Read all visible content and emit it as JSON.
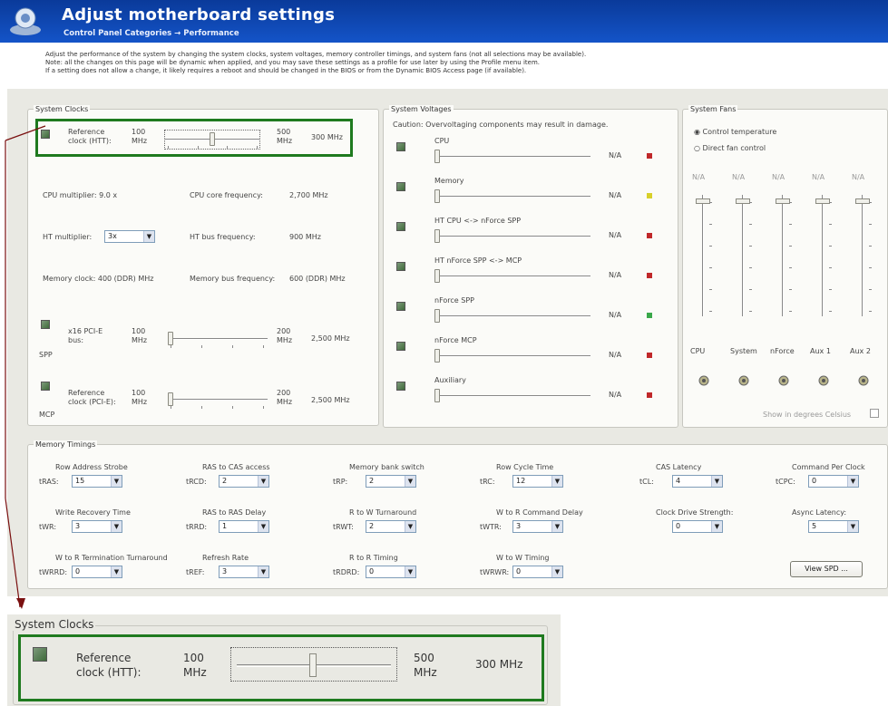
{
  "header": {
    "title": "Adjust motherboard settings",
    "subtitle": "Control Panel Categories  →  Performance"
  },
  "intro": [
    "Adjust the performance of the system by changing the system clocks, system voltages, memory controller timings, and system fans (not all selections may be available).",
    "Note: all the changes on this page will be dynamic when applied, and you may save these settings as a profile for use later by using the Profile menu item.",
    "If a setting does not allow a change, it likely requires a reboot and should be changed in the BIOS or from the Dynamic BIOS Access page (if available)."
  ],
  "clocks": {
    "legend": "System Clocks",
    "ref": {
      "label": "Reference clock (HTT):",
      "min": "100 MHz",
      "max": "500 MHz",
      "value": "300 MHz",
      "level": 0.5
    },
    "cpu_multiplier": "CPU multiplier:  9.0 x",
    "cpu_core_label": "CPU core frequency:",
    "cpu_core_value": "2,700 MHz",
    "ht_mult_label": "HT multiplier:",
    "ht_mult_value": "3x",
    "ht_bus_label": "HT bus frequency:",
    "ht_bus_value": "900 MHz",
    "mem_clock": "Memory clock:  400 (DDR) MHz",
    "mem_bus_label": "Memory bus frequency:",
    "mem_bus_value": "600 (DDR) MHz",
    "pcie": {
      "label": "x16 PCI-E bus:",
      "min": "100 MHz",
      "max": "200 MHz",
      "value": "2,500 MHz",
      "tag": "SPP",
      "level": 0.0
    },
    "pcie2": {
      "label": "Reference clock (PCI-E):",
      "min": "100 MHz",
      "max": "200 MHz",
      "value": "2,500 MHz",
      "tag": "MCP",
      "level": 0.0
    }
  },
  "voltages": {
    "legend": "System Voltages",
    "caution": "Caution: Overvoltaging components may result in damage.",
    "items": [
      {
        "label": "CPU",
        "value": "N/A",
        "color": "#c0282a"
      },
      {
        "label": "Memory",
        "value": "N/A",
        "color": "#d8d02a"
      },
      {
        "label": "HT CPU <-> nForce SPP",
        "value": "N/A",
        "color": "#c0282a"
      },
      {
        "label": "HT nForce SPP <-> MCP",
        "value": "N/A",
        "color": "#c0282a"
      },
      {
        "label": "nForce SPP",
        "value": "N/A",
        "color": "#3aa84a"
      },
      {
        "label": "nForce MCP",
        "value": "N/A",
        "color": "#c0282a"
      },
      {
        "label": "Auxiliary",
        "value": "N/A",
        "color": "#c0282a"
      }
    ]
  },
  "fans": {
    "legend": "System Fans",
    "opt1": "Control temperature",
    "opt2": "Direct fan control",
    "names": [
      "CPU",
      "System",
      "nForce",
      "Aux 1",
      "Aux 2"
    ],
    "values": [
      "N/A",
      "N/A",
      "N/A",
      "N/A",
      "N/A"
    ],
    "celsius": "Show in degrees Celsius"
  },
  "memory": {
    "legend": "Memory Timings",
    "rows": [
      [
        {
          "title": "Row Address Strobe",
          "abbr": "tRAS:",
          "value": "15"
        },
        {
          "title": "RAS to CAS access",
          "abbr": "tRCD:",
          "value": "2"
        },
        {
          "title": "Memory bank switch",
          "abbr": "tRP:",
          "value": "2"
        },
        {
          "title": "Row Cycle Time",
          "abbr": "tRC:",
          "value": "12"
        },
        {
          "title": "CAS Latency",
          "abbr": "tCL:",
          "value": "4"
        },
        {
          "title": "Command Per Clock",
          "abbr": "tCPC:",
          "value": "0"
        }
      ],
      [
        {
          "title": "Write Recovery Time",
          "abbr": "tWR:",
          "value": "3"
        },
        {
          "title": "RAS to RAS Delay",
          "abbr": "tRRD:",
          "value": "1"
        },
        {
          "title": "R to W Turnaround",
          "abbr": "tRWT:",
          "value": "2"
        },
        {
          "title": "W to R Command Delay",
          "abbr": "tWTR:",
          "value": "3"
        },
        {
          "title": "Clock Drive Strength:",
          "abbr": "",
          "value": "0"
        },
        {
          "title": "Async Latency:",
          "abbr": "",
          "value": "5"
        }
      ],
      [
        {
          "title": "W to R Termination Turnaround",
          "abbr": "tWRRD:",
          "value": "0"
        },
        {
          "title": "Refresh Rate",
          "abbr": "tREF:",
          "value": "3"
        },
        {
          "title": "R to R Timing",
          "abbr": "tRDRD:",
          "value": "0"
        },
        {
          "title": "W to W Timing",
          "abbr": "tWRWR:",
          "value": "0"
        }
      ]
    ],
    "spd_button": "View SPD ..."
  },
  "zoom": {
    "legend": "System Clocks",
    "label1": "Reference",
    "label2": "clock (HTT):",
    "min1": "100",
    "min2": "MHz",
    "max1": "500",
    "max2": "MHz",
    "value": "300 MHz"
  }
}
